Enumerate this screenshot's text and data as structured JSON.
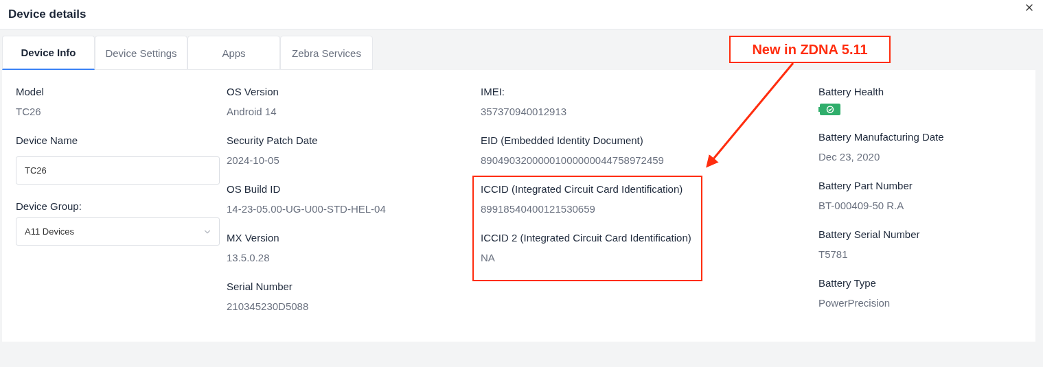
{
  "window": {
    "title": "Device details"
  },
  "tabs": [
    {
      "label": "Device Info",
      "selected": true
    },
    {
      "label": "Device Settings",
      "selected": false
    },
    {
      "label": "Apps",
      "selected": false
    },
    {
      "label": "Zebra Services",
      "selected": false
    }
  ],
  "columns": [
    {
      "fields": [
        {
          "kind": "text",
          "label": "Model",
          "value": "TC26"
        },
        {
          "kind": "input",
          "label": "Device Name",
          "value": "TC26"
        },
        {
          "kind": "select",
          "label": "Device Group:",
          "value": "A11 Devices"
        }
      ]
    },
    {
      "fields": [
        {
          "kind": "text",
          "label": "OS Version",
          "value": "Android 14"
        },
        {
          "kind": "text",
          "label": "Security Patch Date",
          "value": "2024-10-05"
        },
        {
          "kind": "text",
          "label": "OS Build ID",
          "value": "14-23-05.00-UG-U00-STD-HEL-04"
        },
        {
          "kind": "text",
          "label": "MX Version",
          "value": "13.5.0.28"
        },
        {
          "kind": "text",
          "label": "Serial Number",
          "value": "210345230D5088"
        }
      ]
    },
    {
      "fields": [
        {
          "kind": "text",
          "label": "IMEI:",
          "value": "357370940012913",
          "highlighted": false
        },
        {
          "kind": "text",
          "label": "EID (Embedded Identity Document)",
          "value": "89049032000001000000044758972459",
          "highlighted": false
        },
        {
          "kind": "text",
          "label": "ICCID (Integrated Circuit Card Identification)",
          "value": "89918540400121530659",
          "highlighted": true
        },
        {
          "kind": "text",
          "label": "ICCID 2 (Integrated Circuit Card Identification)",
          "value": "NA",
          "highlighted": true
        }
      ]
    },
    {
      "fields": [
        {
          "kind": "battery",
          "label": "Battery Health"
        },
        {
          "kind": "text",
          "label": "Battery Manufacturing Date",
          "value": "Dec 23, 2020"
        },
        {
          "kind": "text",
          "label": "Battery Part Number",
          "value": "BT-000409-50 R.A"
        },
        {
          "kind": "text",
          "label": "Battery Serial Number",
          "value": "T5781"
        },
        {
          "kind": "text",
          "label": "Battery Type",
          "value": "PowerPrecision"
        }
      ]
    }
  ],
  "annotation": {
    "label": "New in ZDNA 5.11"
  }
}
